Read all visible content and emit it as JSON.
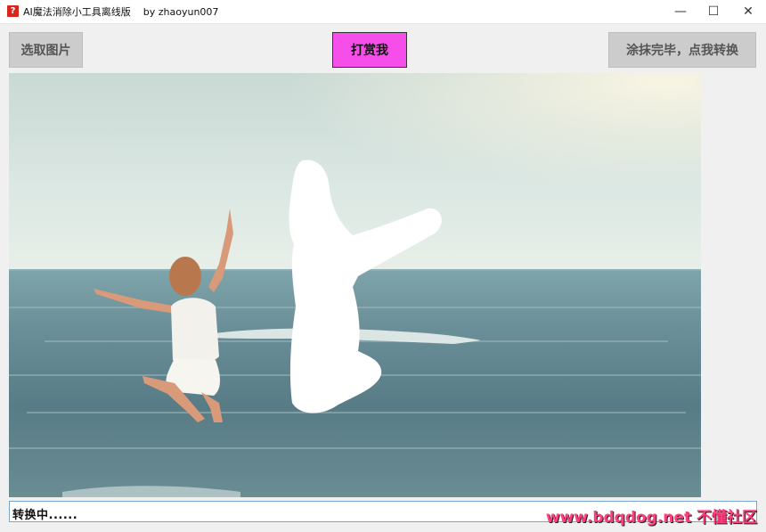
{
  "window": {
    "title": "AI魔法消除小工具离线版    by zhaoyun007",
    "app_icon_glyph": "?",
    "minimize_glyph": "—",
    "maximize_glyph": "☐",
    "close_glyph": "✕"
  },
  "toolbar": {
    "select_image_label": "选取图片",
    "donate_label": "打赏我",
    "convert_label": "涂抹完毕，点我转换"
  },
  "colors": {
    "donate_button": "#f64ee9",
    "brush_mask": "#ffffff"
  },
  "status": {
    "text": "转换中......"
  },
  "watermark": {
    "text": "www.bdqdog.net 不懂社区"
  }
}
